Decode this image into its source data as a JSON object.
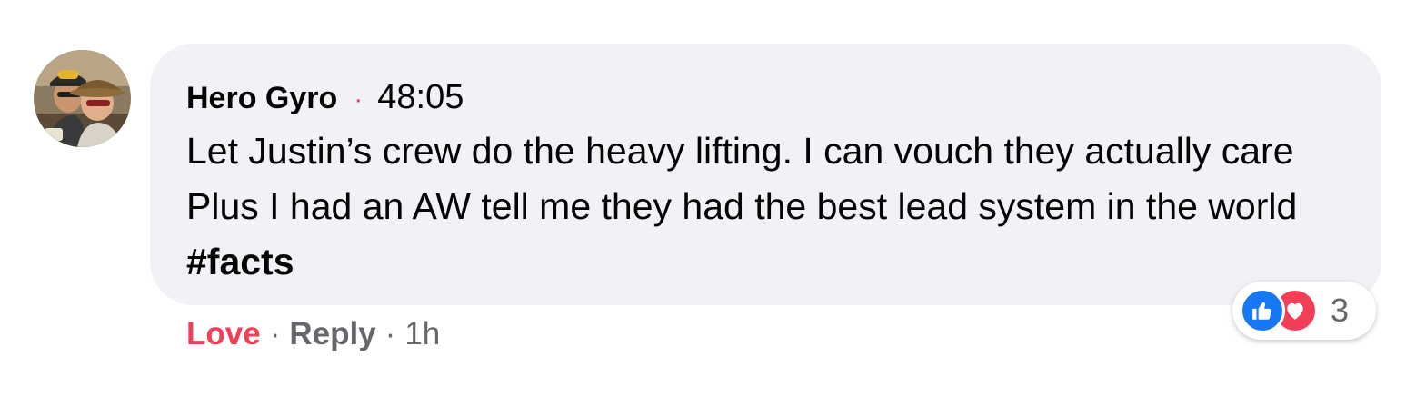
{
  "comment": {
    "author": "Hero Gyro",
    "separator": "·",
    "timestamp": "48:05",
    "text": "Let Justin’s crew do the heavy lifting. I can vouch they actually care Plus I had an AW tell me they had the best lead system in the world ",
    "hashtag": "#facts"
  },
  "actions": {
    "love_label": "Love",
    "separator": "·",
    "reply_label": "Reply",
    "time_ago": "1h"
  },
  "reactions": {
    "icons": [
      "like-icon",
      "love-icon"
    ],
    "count": "3"
  },
  "colors": {
    "bubble_bg": "#f0f2f5",
    "love_red": "#f33e58",
    "like_blue": "#1877f2",
    "muted_gray": "#65676b"
  }
}
